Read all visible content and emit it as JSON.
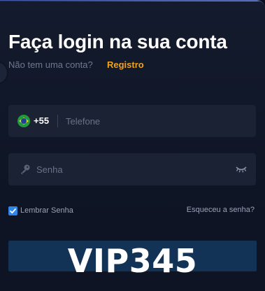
{
  "login": {
    "title": "Faça login na sua conta",
    "no_account_text": "Não tem uma conta?",
    "register_label": "Registro"
  },
  "phone": {
    "country_flag": "brazil-flag-icon",
    "country_code": "+55",
    "placeholder": "Telefone",
    "value": ""
  },
  "password": {
    "placeholder": "Senha",
    "value": "",
    "leading_icon": "key-icon",
    "toggle_icon": "eye-closed-icon"
  },
  "remember": {
    "label": "Lembrar Senha",
    "checked": true
  },
  "forgot_label": "Esqueceu a senha?",
  "watermark": "VIP345",
  "colors": {
    "accent": "#f0a31c",
    "background": "#141b2e",
    "field_background": "#1b2234",
    "checkbox": "#2f86e8",
    "button": "#123356"
  }
}
